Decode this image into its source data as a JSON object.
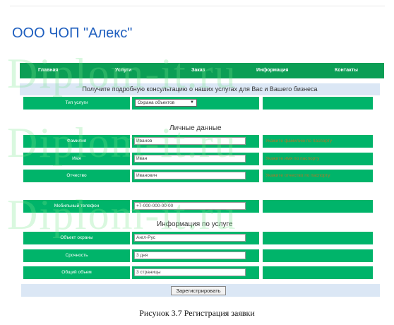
{
  "company": "ООО ЧОП \"Алекс\"",
  "nav": [
    "Главная",
    "Услуги",
    "Заказ",
    "Информация",
    "Контакты"
  ],
  "banner": "Получите подробную консультацию о наших услугах для Вас и Вашего бизнеса",
  "service_type": {
    "label": "Тип услуги",
    "value": "Охрана объектов"
  },
  "personal_title": "Личные данные",
  "personal": [
    {
      "label": "Фамилия",
      "value": "Иванов",
      "hint": "Укажите фамилию по паспорту"
    },
    {
      "label": "Имя",
      "value": "Иван",
      "hint": "Укажите имя по паспорту"
    },
    {
      "label": "Отчество",
      "value": "Иванович",
      "hint": "Укажите отчество по паспорту"
    }
  ],
  "phone": {
    "label": "Мобильный телефон",
    "value": "+7-000-000-00-00"
  },
  "service_title": "Информация по услуге",
  "service": [
    {
      "label": "Объект охраны",
      "value": "Англ-Рус"
    },
    {
      "label": "Срочность",
      "value": "3 дня"
    },
    {
      "label": "Общий объем",
      "value": "3 страницы"
    }
  ],
  "submit": "Зарегистрировать",
  "caption": "Рисунок 3.7 Регистрация заявки",
  "watermark": "Diplom-it.ru",
  "colors": {
    "nav": "#0b9e55",
    "row": "#00b46a",
    "banner": "#dbe7f5",
    "title": "#1f5fbf"
  }
}
